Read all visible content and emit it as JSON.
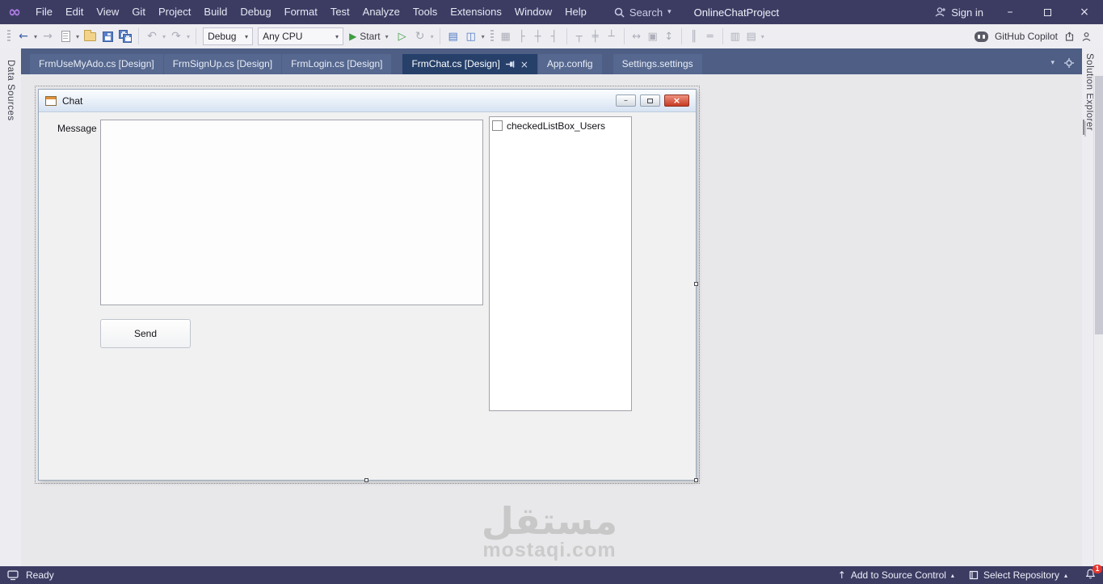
{
  "titlebar": {
    "menus": [
      "File",
      "Edit",
      "View",
      "Git",
      "Project",
      "Build",
      "Debug",
      "Format",
      "Test",
      "Analyze",
      "Tools",
      "Extensions",
      "Window",
      "Help"
    ],
    "search_label": "Search",
    "solution_name": "OnlineChatProject",
    "sign_in_label": "Sign in"
  },
  "toolbar": {
    "configuration": "Debug",
    "platform": "Any CPU",
    "start_label": "Start",
    "copilot_label": "GitHub Copilot"
  },
  "tabs": [
    {
      "label": "FrmUseMyAdo.cs [Design]",
      "active": false
    },
    {
      "label": "FrmSignUp.cs [Design]",
      "active": false
    },
    {
      "label": "FrmLogin.cs [Design]",
      "active": false
    },
    {
      "label": "FrmChat.cs [Design]",
      "active": true
    },
    {
      "label": "App.config",
      "active": false
    },
    {
      "label": "Settings.settings",
      "active": false
    }
  ],
  "side_panels": {
    "left_tab": "Data Sources",
    "right_tab": "Solution Explorer"
  },
  "designer_form": {
    "title": "Chat",
    "message_label": "Message",
    "send_button_label": "Send",
    "checked_list_item": "checkedListBox_Users"
  },
  "watermark": {
    "line1": "مستقل",
    "line2": "mostaqi.com"
  },
  "statusbar": {
    "ready_label": "Ready",
    "add_to_source_control_label": "Add to Source Control",
    "select_repository_label": "Select Repository",
    "notification_count": "1"
  },
  "colors": {
    "titlebar_bg": "#3C3C63",
    "toolbar_bg": "#EEEEF2",
    "tabstrip_bg": "#4E5E84",
    "active_tab_bg": "#26406A",
    "status_bg": "#3C3C63",
    "close_button_red": "#C63A22",
    "start_green": "#3E9B41"
  },
  "icons": {
    "back": "←",
    "forward": "→",
    "caret": "▾",
    "caret_up": "▴",
    "undo": "↶",
    "redo": "↷",
    "play": "▶",
    "play_outline": "▷",
    "refresh": "↻",
    "close": "×",
    "minimize": "–",
    "up_arrow": "↑",
    "infinity_logo": "∞",
    "window_blue": "▤",
    "split_blue": "◫",
    "snap_grid": "▦",
    "align_lefts": "├",
    "align_centers": "┼",
    "align_rights": "┤",
    "align_tops": "┬",
    "align_middles": "╪",
    "align_bottoms": "┴",
    "same_width": "↔",
    "same_size": "▣",
    "same_height": "↕",
    "h_spacing": "║",
    "v_spacing": "═",
    "bring_front": "▥",
    "send_back": "▤"
  }
}
